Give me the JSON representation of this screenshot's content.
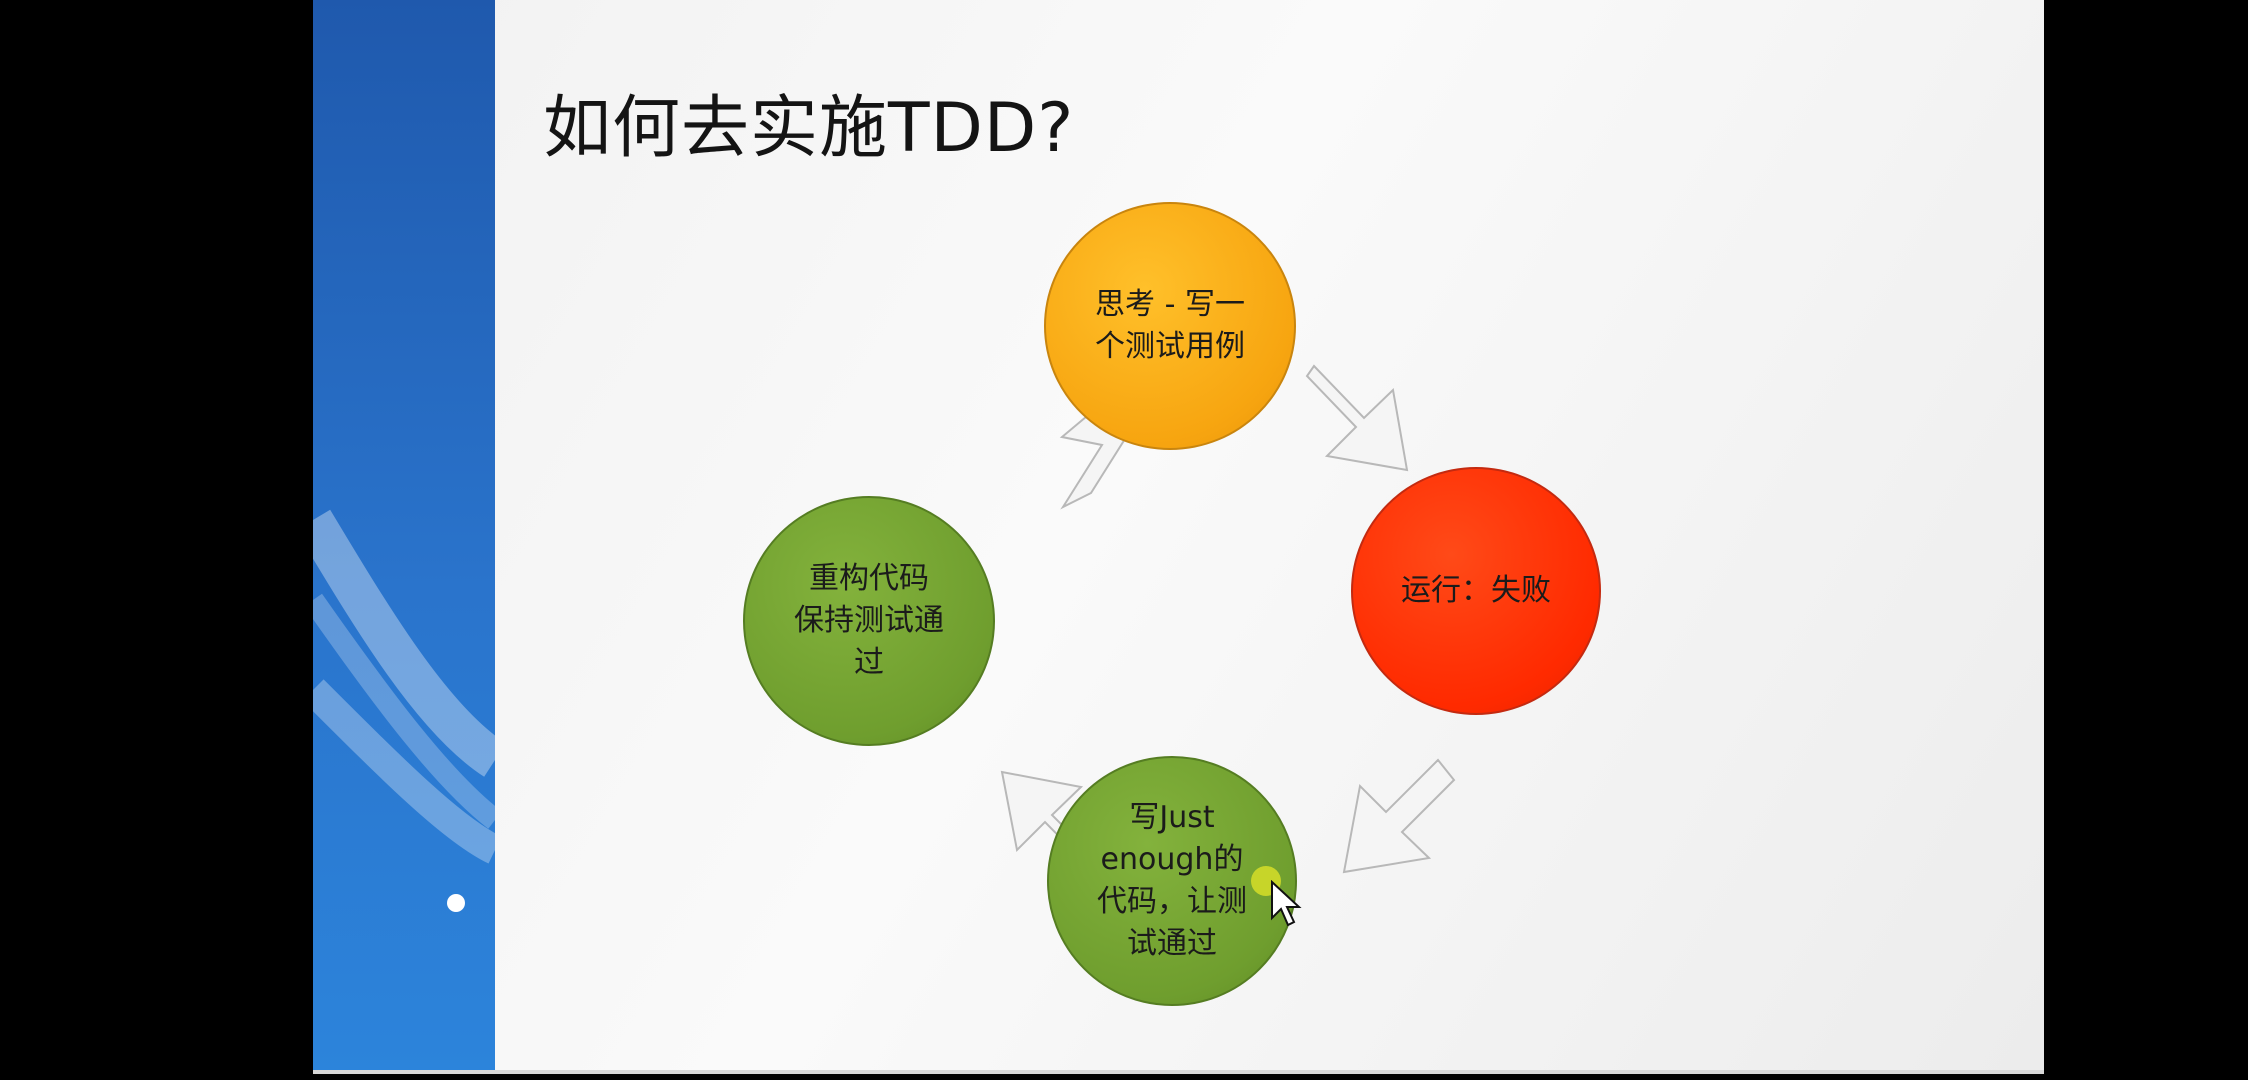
{
  "slide": {
    "title": "如何去实施TDD?",
    "nodes": [
      {
        "id": "think",
        "label": "思考 - 写一\n个测试用例",
        "color": "#f8a810"
      },
      {
        "id": "run",
        "label": "运行：失败",
        "color": "#ff2a00"
      },
      {
        "id": "write",
        "label": "写Just\nenough的\n代码，让测\n试通过",
        "color": "#6f9e2e"
      },
      {
        "id": "refactor",
        "label": "重构代码\n保持测试通\n过",
        "color": "#6f9e2e"
      }
    ]
  },
  "icons": [
    "arrow-icon",
    "mouse-pointer-icon"
  ]
}
